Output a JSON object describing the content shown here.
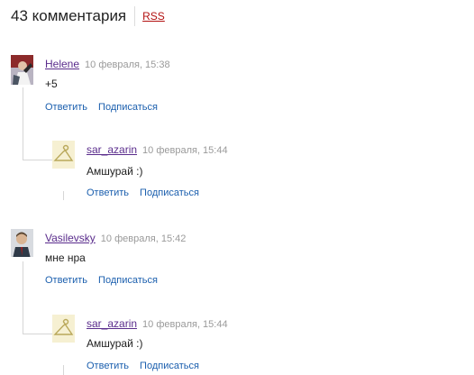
{
  "header": {
    "count_text": "43 комментария",
    "rss_label": "RSS"
  },
  "actions": {
    "reply": "Ответить",
    "subscribe": "Подписаться"
  },
  "comments": [
    {
      "author": "Helene",
      "date": "10 февраля, 15:38",
      "text": "+5",
      "avatar": "female-portrait-avatar",
      "reply": {
        "author": "sar_azarin",
        "date": "10 февраля, 15:44",
        "text": "Амшурай :)",
        "avatar": "hanger-avatar"
      }
    },
    {
      "author": "Vasilevsky",
      "date": "10 февраля, 15:42",
      "text": "мне нра",
      "avatar": "male-portrait-avatar",
      "reply": {
        "author": "sar_azarin",
        "date": "10 февраля, 15:44",
        "text": "Амшурай :)",
        "avatar": "hanger-avatar"
      }
    }
  ],
  "colors": {
    "author_link": "#5a2c8c",
    "action_link": "#1b5fae",
    "rss_link": "#b20f0f",
    "date": "#9a9a9a"
  }
}
